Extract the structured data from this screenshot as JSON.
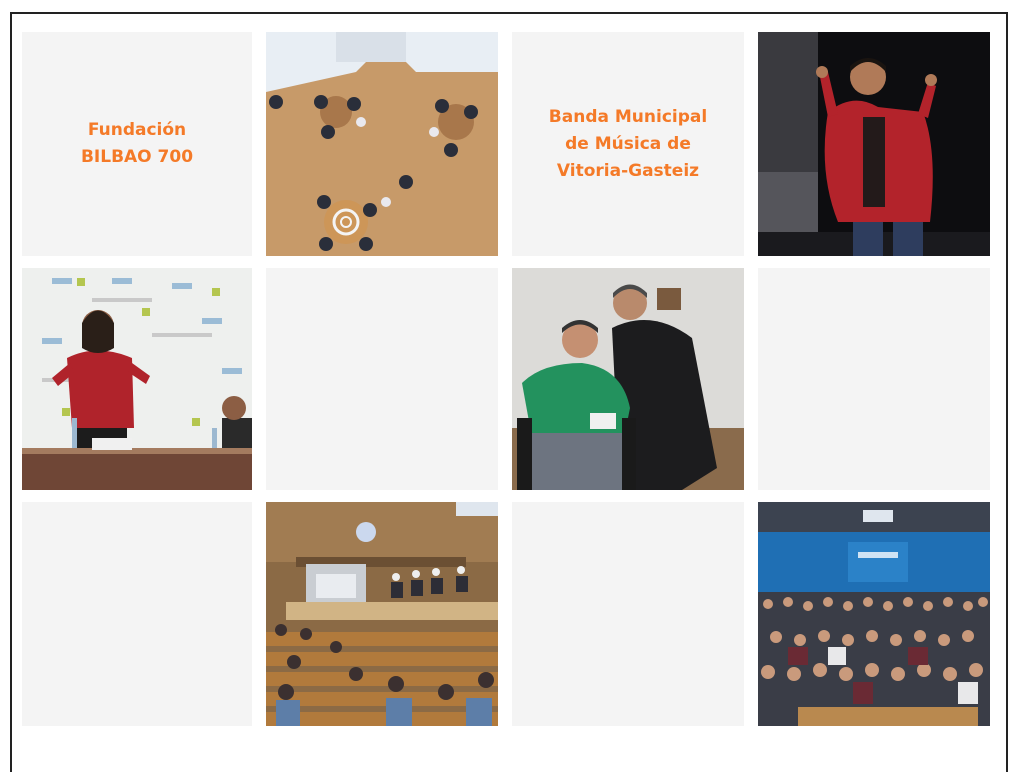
{
  "colors": {
    "label": "#f47a28",
    "tile_bg": "#f4f4f4",
    "frame": "#222222"
  },
  "tiles": [
    {
      "kind": "text",
      "label": "Fundación\nBILBAO 700"
    },
    {
      "kind": "photo",
      "subject": "workshop tables from above"
    },
    {
      "kind": "text",
      "label": "Banda Municipal\nde Música de\nVitoria-Gasteiz"
    },
    {
      "kind": "photo",
      "subject": "speaker on dark stage"
    },
    {
      "kind": "photo",
      "subject": "speaker at conference table"
    },
    {
      "kind": "empty"
    },
    {
      "kind": "photo",
      "subject": "two men, one in wheelchair"
    },
    {
      "kind": "empty"
    },
    {
      "kind": "empty"
    },
    {
      "kind": "photo",
      "subject": "auditorium with panel"
    },
    {
      "kind": "empty"
    },
    {
      "kind": "photo",
      "subject": "large group photo"
    }
  ]
}
